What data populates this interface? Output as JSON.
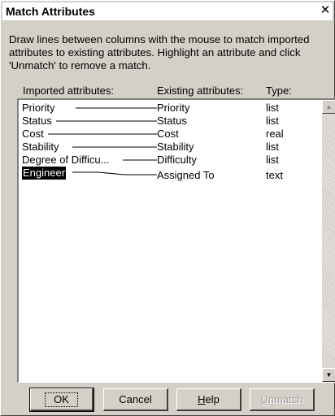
{
  "dialog": {
    "title": "Match Attributes",
    "close_glyph": "✕",
    "instructions": "Draw lines between columns with the mouse to match imported\nattributes to existing attributes. Highlight an attribute and click\n'Unmatch' to remove a match."
  },
  "headers": {
    "imported": "Imported attributes:",
    "existing": "Existing attributes:",
    "type": "Type:"
  },
  "rows": [
    {
      "imported": "Priority",
      "existing": "Priority",
      "type": "list"
    },
    {
      "imported": "Status",
      "existing": "Status",
      "type": "list"
    },
    {
      "imported": "Cost",
      "existing": "Cost",
      "type": "real"
    },
    {
      "imported": "Stability",
      "existing": "Stability",
      "type": "list"
    },
    {
      "imported": "Degree of Difficu...",
      "existing": "Difficulty",
      "type": "list"
    },
    {
      "imported": "Engineer",
      "existing": "Assigned To",
      "type": "text",
      "selected": true
    }
  ],
  "buttons": {
    "ok": "OK",
    "cancel": "Cancel",
    "help_prefix": "",
    "help_underlined": "H",
    "help_rest": "elp",
    "unmatch_underlined": "U",
    "unmatch_rest": "nmatch"
  },
  "colors": {
    "face": "#d4d0c8",
    "selection": "#000000"
  }
}
